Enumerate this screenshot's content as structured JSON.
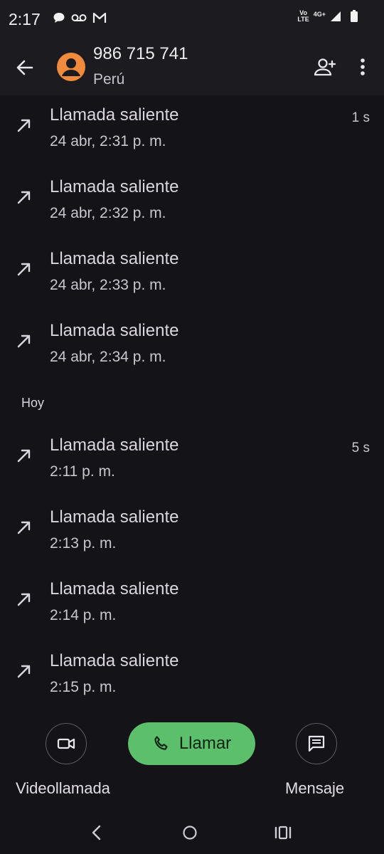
{
  "status_bar": {
    "time": "2:17",
    "volte_top": "Vo",
    "volte_bottom": "LTE",
    "network": "4G+"
  },
  "header": {
    "number": "986 715 741",
    "country": "Perú"
  },
  "calls": [
    {
      "type": "Llamada saliente",
      "time": "24 abr, 2:31 p. m.",
      "duration": "1 s"
    },
    {
      "type": "Llamada saliente",
      "time": "24 abr, 2:32 p. m.",
      "duration": ""
    },
    {
      "type": "Llamada saliente",
      "time": "24 abr, 2:33 p. m.",
      "duration": ""
    },
    {
      "type": "Llamada saliente",
      "time": "24 abr, 2:34 p. m.",
      "duration": ""
    },
    {
      "type": "Llamada saliente",
      "time": "2:11 p. m.",
      "duration": "5 s"
    },
    {
      "type": "Llamada saliente",
      "time": "2:13 p. m.",
      "duration": ""
    },
    {
      "type": "Llamada saliente",
      "time": "2:14 p. m.",
      "duration": ""
    },
    {
      "type": "Llamada saliente",
      "time": "2:15 p. m.",
      "duration": ""
    }
  ],
  "section_today": "Hoy",
  "actions": {
    "video_label": "Videollamada",
    "call_label": "Llamar",
    "message_label": "Mensaje"
  },
  "icons": {
    "back": "arrow-left-icon",
    "add_contact": "person-add-icon",
    "more": "more-vert-icon",
    "outgoing": "call-made-icon",
    "video": "videocam-icon",
    "phone": "phone-icon",
    "message": "message-icon"
  },
  "colors": {
    "background": "#141317",
    "appbar": "#1c1b20",
    "avatar": "#f08a3c",
    "call_button": "#5cbf6c"
  }
}
